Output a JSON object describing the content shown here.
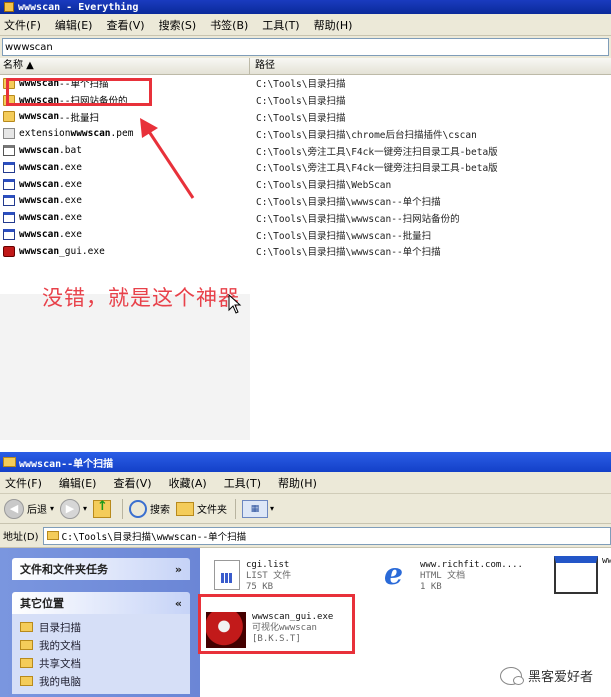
{
  "everything": {
    "title": "wwwscan - Everything",
    "menu": [
      "文件(F)",
      "编辑(E)",
      "查看(V)",
      "搜索(S)",
      "书签(B)",
      "工具(T)",
      "帮助(H)"
    ],
    "search_value": "wwwscan",
    "columns": {
      "name": "名称 ▲",
      "path": "路径"
    },
    "rows": [
      {
        "icon": "folder",
        "pre": "",
        "bold": "wwwscan",
        "post": "--单个扫描",
        "path": "C:\\Tools\\目录扫描"
      },
      {
        "icon": "folder",
        "pre": "",
        "bold": "wwwscan",
        "post": "--扫网站备份的",
        "path": "C:\\Tools\\目录扫描"
      },
      {
        "icon": "folder",
        "pre": "",
        "bold": "wwwscan",
        "post": "--批量扫",
        "path": "C:\\Tools\\目录扫描"
      },
      {
        "icon": "pem",
        "pre": "extension",
        "bold": "wwwscan",
        "post": ".pem",
        "path": "C:\\Tools\\目录扫描\\chrome后台扫描插件\\cscan"
      },
      {
        "icon": "bat",
        "pre": "",
        "bold": "wwwscan",
        "post": ".bat",
        "path": "C:\\Tools\\旁注工具\\F4ck一键旁注扫目录工具-beta版"
      },
      {
        "icon": "file",
        "pre": "",
        "bold": "wwwscan",
        "post": ".exe",
        "path": "C:\\Tools\\旁注工具\\F4ck一键旁注扫目录工具-beta版"
      },
      {
        "icon": "file",
        "pre": "",
        "bold": "wwwscan",
        "post": ".exe",
        "path": "C:\\Tools\\目录扫描\\WebScan"
      },
      {
        "icon": "file",
        "pre": "",
        "bold": "wwwscan",
        "post": ".exe",
        "path": "C:\\Tools\\目录扫描\\wwwscan--单个扫描"
      },
      {
        "icon": "file",
        "pre": "",
        "bold": "wwwscan",
        "post": ".exe",
        "path": "C:\\Tools\\目录扫描\\wwwscan--扫网站备份的"
      },
      {
        "icon": "file",
        "pre": "",
        "bold": "wwwscan",
        "post": ".exe",
        "path": "C:\\Tools\\目录扫描\\wwwscan--批量扫"
      },
      {
        "icon": "gui",
        "pre": "",
        "bold": "wwwscan",
        "post": "_gui.exe",
        "path": "C:\\Tools\\目录扫描\\wwwscan--单个扫描"
      }
    ],
    "annotation": "没错，就是这个神器",
    "accent_color": "#e8313a"
  },
  "explorer": {
    "title": "wwwscan--单个扫描",
    "menu": [
      "文件(F)",
      "编辑(E)",
      "查看(V)",
      "收藏(A)",
      "工具(T)",
      "帮助(H)"
    ],
    "toolbar": {
      "back": "后退",
      "search": "搜索",
      "folders": "文件夹"
    },
    "address_label": "地址(D)",
    "address": "C:\\Tools\\目录扫描\\wwwscan--单个扫描",
    "task_sections": [
      {
        "title": "文件和文件夹任务",
        "chevron": "»"
      },
      {
        "title": "其它位置",
        "chevron": "«"
      }
    ],
    "other_places": [
      "目录扫描",
      "我的文档",
      "共享文档",
      "我的电脑"
    ],
    "files": [
      {
        "name": "cgi.list",
        "type": "LIST 文件",
        "size": "75 KB"
      },
      {
        "name": "www.richfit.com....",
        "type": "HTML 文档",
        "size": "1 KB"
      },
      {
        "name": "ww",
        "type": "",
        "size": ""
      },
      {
        "name": "wwwscan_gui.exe",
        "type": "可视化wwwscan",
        "size": "[B.K.S.T]"
      }
    ]
  },
  "watermark": "黑客爱好者"
}
